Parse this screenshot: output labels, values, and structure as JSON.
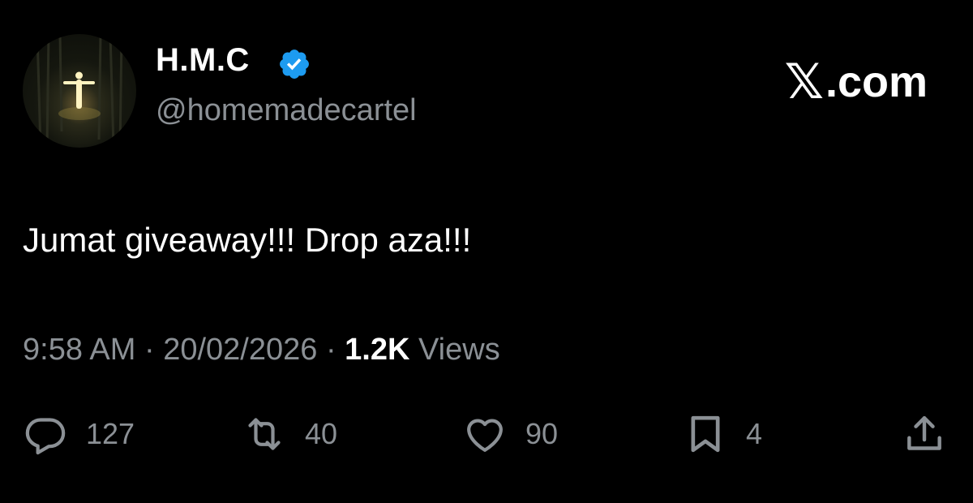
{
  "profile": {
    "display_name": "H.M.C",
    "handle": "@homemadecartel",
    "verified_badge_color": "#1d9bf0",
    "avatar_icon": "avatar"
  },
  "brand": {
    "x_glyph": "𝕏",
    "label": ".com"
  },
  "tweet": {
    "text": "Jumat giveaway!!! Drop aza!!!"
  },
  "meta": {
    "time": "9:58 AM",
    "sep1": " · ",
    "date": "20/02/2026",
    "sep2": " · ",
    "views_count": "1.2K",
    "views_label": " Views"
  },
  "actions": {
    "replies": "127",
    "reposts": "40",
    "likes": "90",
    "bookmarks": "4"
  },
  "colors": {
    "background": "#000000",
    "primary_text": "#ffffff",
    "secondary_text": "#8b9095",
    "accent": "#1d9bf0"
  }
}
